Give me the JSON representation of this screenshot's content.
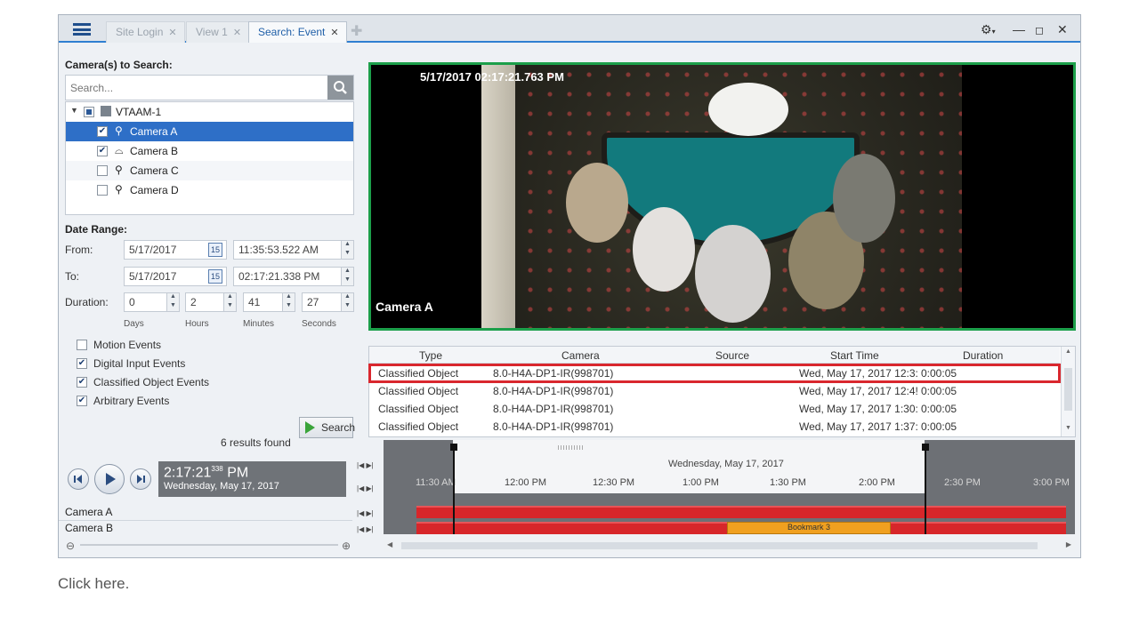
{
  "tabs": [
    {
      "label": "Site Login"
    },
    {
      "label": "View 1"
    },
    {
      "label": "Search: Event"
    }
  ],
  "cameras_section": {
    "title": "Camera(s) to Search:",
    "search_placeholder": "Search...",
    "tree": {
      "root": "VTAAM-1",
      "items": [
        {
          "label": "Camera A",
          "checked": true
        },
        {
          "label": "Camera B",
          "checked": true
        },
        {
          "label": "Camera C",
          "checked": false
        },
        {
          "label": "Camera D",
          "checked": false
        }
      ]
    }
  },
  "date_range": {
    "title": "Date Range:",
    "from_label": "From:",
    "from_date": "5/17/2017",
    "from_time": "11:35:53.522 AM",
    "to_label": "To:",
    "to_date": "5/17/2017",
    "to_time": "02:17:21.338 PM",
    "duration_label": "Duration:",
    "duration": {
      "days": "0",
      "hours": "2",
      "minutes": "41",
      "seconds": "27"
    },
    "units": {
      "days": "Days",
      "hours": "Hours",
      "minutes": "Minutes",
      "seconds": "Seconds"
    },
    "calendar_icon_text": "15"
  },
  "event_types": [
    {
      "label": "Motion Events",
      "checked": false
    },
    {
      "label": "Digital Input Events",
      "checked": true
    },
    {
      "label": "Classified Object Events",
      "checked": true
    },
    {
      "label": "Arbitrary Events",
      "checked": true
    }
  ],
  "results_summary": {
    "count": "6",
    "text": "results found"
  },
  "search_button": "Search",
  "video": {
    "timestamp": "5/17/2017 02:17:21.763 PM",
    "camera_label": "Camera A"
  },
  "results_table": {
    "columns": [
      "Type",
      "Camera",
      "Source",
      "Start Time",
      "Duration"
    ],
    "rows": [
      {
        "type": "Classified Object",
        "camera": "8.0-H4A-DP1-IR(998701)",
        "source": "",
        "start": "Wed, May 17, 2017 12:3:",
        "duration": "0:00:05"
      },
      {
        "type": "Classified Object",
        "camera": "8.0-H4A-DP1-IR(998701)",
        "source": "",
        "start": "Wed, May 17, 2017 12:4!",
        "duration": "0:00:05"
      },
      {
        "type": "Classified Object",
        "camera": "8.0-H4A-DP1-IR(998701)",
        "source": "",
        "start": "Wed, May 17, 2017 1:30:",
        "duration": "0:00:05"
      },
      {
        "type": "Classified Object",
        "camera": "8.0-H4A-DP1-IR(998701)",
        "source": "",
        "start": "Wed, May 17, 2017 1:37:",
        "duration": "0:00:05"
      }
    ]
  },
  "player": {
    "time": "2:17:21",
    "ms": "338",
    "ampm": "PM",
    "date": "Wednesday, May 17, 2017"
  },
  "timeline": {
    "date": "Wednesday, May 17, 2017",
    "ticks": [
      "11:30 AM",
      "12:00 PM",
      "12:30 PM",
      "1:00 PM",
      "1:30 PM",
      "2:00 PM",
      "2:30 PM",
      "3:00 PM"
    ],
    "tracks": [
      "Camera A",
      "Camera B"
    ],
    "bookmark": "Bookmark 3"
  },
  "footer_text": "Click here."
}
